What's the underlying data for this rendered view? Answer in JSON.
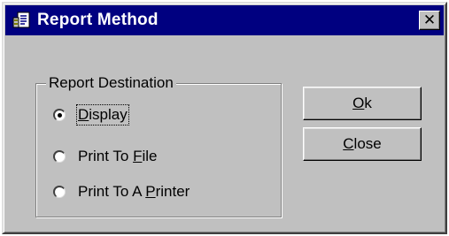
{
  "window": {
    "title": "Report Method",
    "close_glyph": "✕"
  },
  "group": {
    "label": "Report Destination",
    "options": [
      {
        "pre": "",
        "accel": "D",
        "post": "isplay",
        "selected": true
      },
      {
        "pre": "Print To ",
        "accel": "F",
        "post": "ile",
        "selected": false
      },
      {
        "pre": "Print To A ",
        "accel": "P",
        "post": "rinter",
        "selected": false
      }
    ]
  },
  "buttons": {
    "ok": {
      "accel": "O",
      "rest": "k"
    },
    "close": {
      "accel": "C",
      "rest": "lose"
    }
  },
  "colors": {
    "titlebar": "#000080",
    "face": "#c0c0c0"
  },
  "icons": {
    "app": "report-app-icon",
    "close": "close-icon"
  }
}
